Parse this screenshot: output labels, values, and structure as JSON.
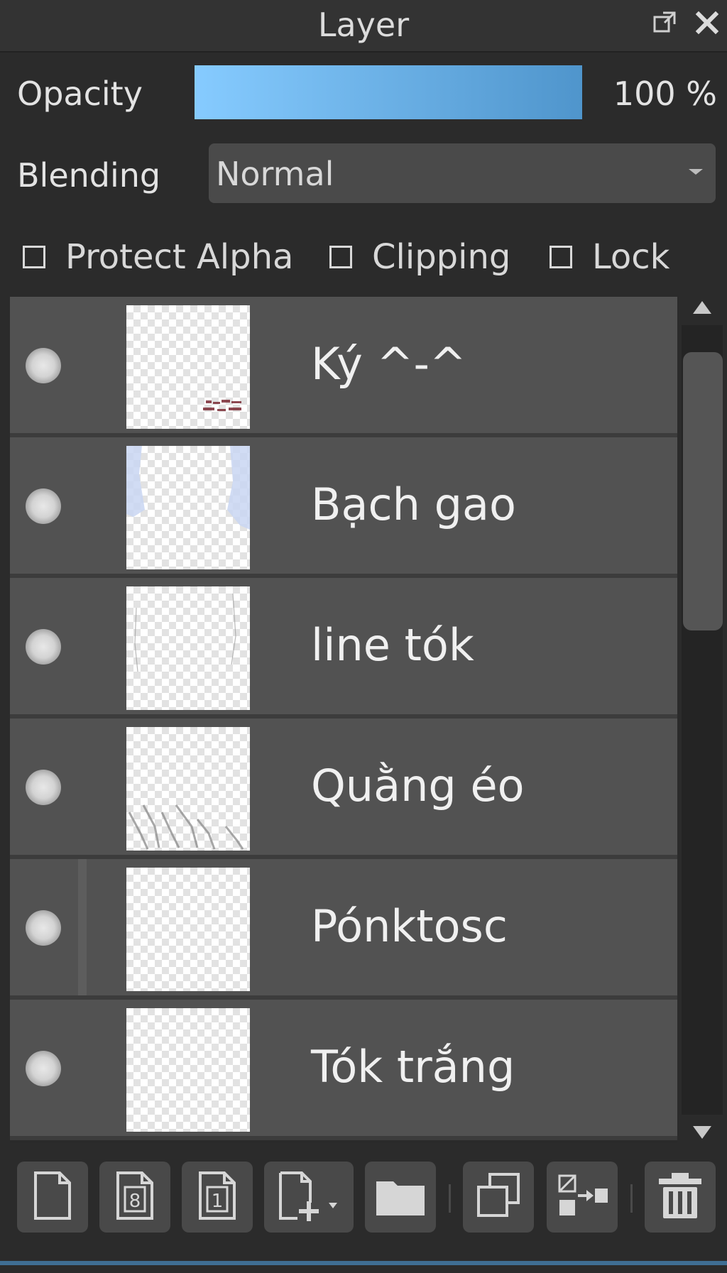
{
  "panel": {
    "title": "Layer"
  },
  "opacity": {
    "label": "Opacity",
    "value_text": "100 %",
    "percent": 100,
    "fill_color_start": "#86cbff",
    "fill_color_end": "#4f95cc"
  },
  "blending": {
    "label": "Blending",
    "selected": "Normal"
  },
  "options": {
    "protect_alpha": {
      "label": "Protect Alpha",
      "checked": false
    },
    "clipping": {
      "label": "Clipping",
      "checked": false
    },
    "lock": {
      "label": "Lock",
      "checked": false
    }
  },
  "layers": [
    {
      "name": "Ký ^-^",
      "visible": true
    },
    {
      "name": "Bạch gao",
      "visible": true
    },
    {
      "name": "line tók",
      "visible": true
    },
    {
      "name": "Quằng éo",
      "visible": true
    },
    {
      "name": "Pónktosc",
      "visible": true
    },
    {
      "name": "Tók trắng",
      "visible": true
    }
  ],
  "toolbar": {
    "icons": [
      "new-layer-icon",
      "new-8bit-layer-icon",
      "new-1bit-layer-icon",
      "add-layer-menu-icon",
      "new-folder-icon",
      "duplicate-layer-icon",
      "merge-layer-icon",
      "delete-layer-icon"
    ]
  },
  "colors": {
    "panel_bg": "#2b2b2b",
    "row_bg": "#525252",
    "accent": "#3f6e93"
  }
}
